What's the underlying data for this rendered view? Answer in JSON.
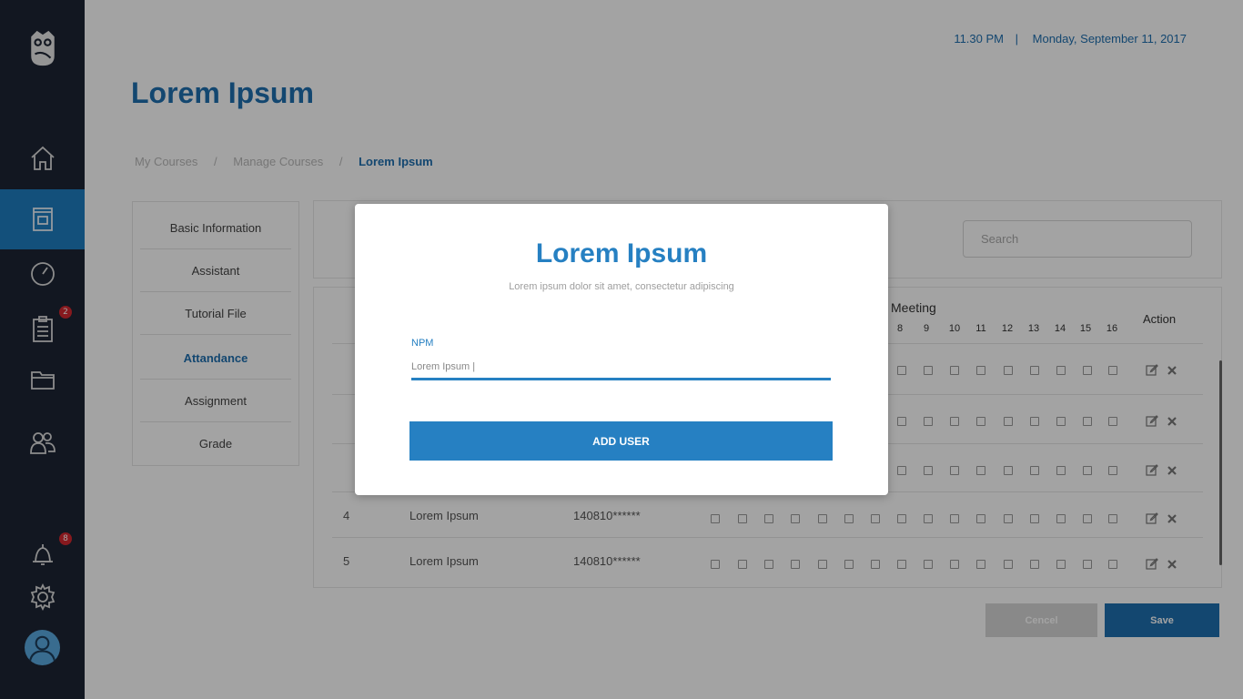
{
  "header": {
    "time": "11.30 PM",
    "separator": "|",
    "date": "Monday, September 11, 2017",
    "title": "Lorem Ipsum"
  },
  "breadcrumb": {
    "items": [
      "My Courses",
      "Manage Courses",
      "Lorem Ipsum"
    ],
    "separator": "/"
  },
  "sidebar": {
    "badges": {
      "tasks": "2",
      "notifications": "8"
    }
  },
  "menu": {
    "items": [
      "Basic Information",
      "Assistant",
      "Tutorial File",
      "Attandance",
      "Assignment",
      "Grade"
    ],
    "active": "Attandance"
  },
  "search": {
    "placeholder": "Search"
  },
  "table": {
    "meeting_label": "Meeting",
    "action_label": "Action",
    "visible_meeting_numbers": [
      "8",
      "9",
      "10",
      "11",
      "12",
      "13",
      "14",
      "15",
      "16"
    ],
    "rows": [
      {
        "no": "4",
        "name": "Lorem Ipsum",
        "npm": "140810******"
      },
      {
        "no": "5",
        "name": "Lorem Ipsum",
        "npm": "140810******"
      }
    ]
  },
  "buttons": {
    "cancel": "Cencel",
    "save": "Save"
  },
  "modal": {
    "title": "Lorem Ipsum",
    "subtitle": "Lorem ipsum dolor sit amet, consectetur adipiscing",
    "field_label": "NPM",
    "field_value": "Lorem Ipsum |",
    "button": "ADD USER"
  },
  "colors": {
    "sidebar_bg": "#1d2534",
    "accent": "#2680c2",
    "primary_dark": "#1f6fb0",
    "badge": "#d3282f"
  }
}
